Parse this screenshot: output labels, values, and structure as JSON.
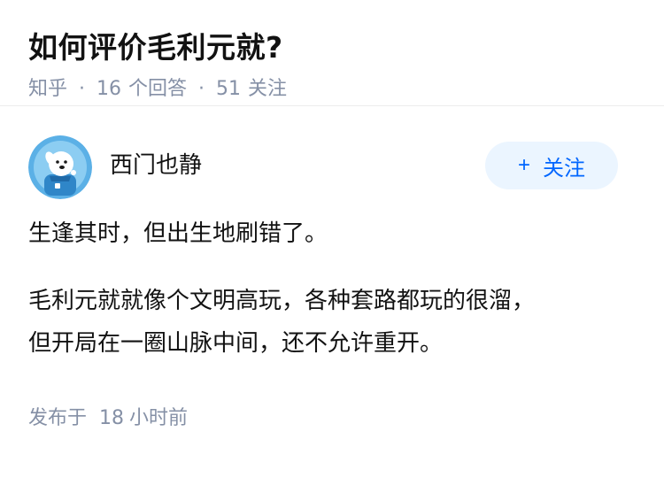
{
  "question": {
    "title": "如何评价毛利元就?",
    "source": "知乎",
    "separator": "·",
    "answers_count": "16",
    "answers_label": "个回答",
    "followers_count": "51",
    "followers_label": "关注"
  },
  "answer": {
    "author": {
      "name": "西门也静",
      "avatar_icon": "avatar-cartoon-dog-icon"
    },
    "follow_button": {
      "plus": "+",
      "label": "关注"
    },
    "paragraphs": [
      "生逢其时，但出生地刷错了。",
      "毛利元就就像个文明高玩，各种套路都玩的很溜，",
      "但开局在一圈山脉中间，还不允许重开。"
    ],
    "published": {
      "prefix": "发布于",
      "count": "18",
      "suffix": "小时前"
    }
  },
  "colors": {
    "accent": "#0066ff",
    "accent_bg": "#ebf5ff",
    "meta_text": "#8590a6",
    "body_text": "#121212"
  }
}
